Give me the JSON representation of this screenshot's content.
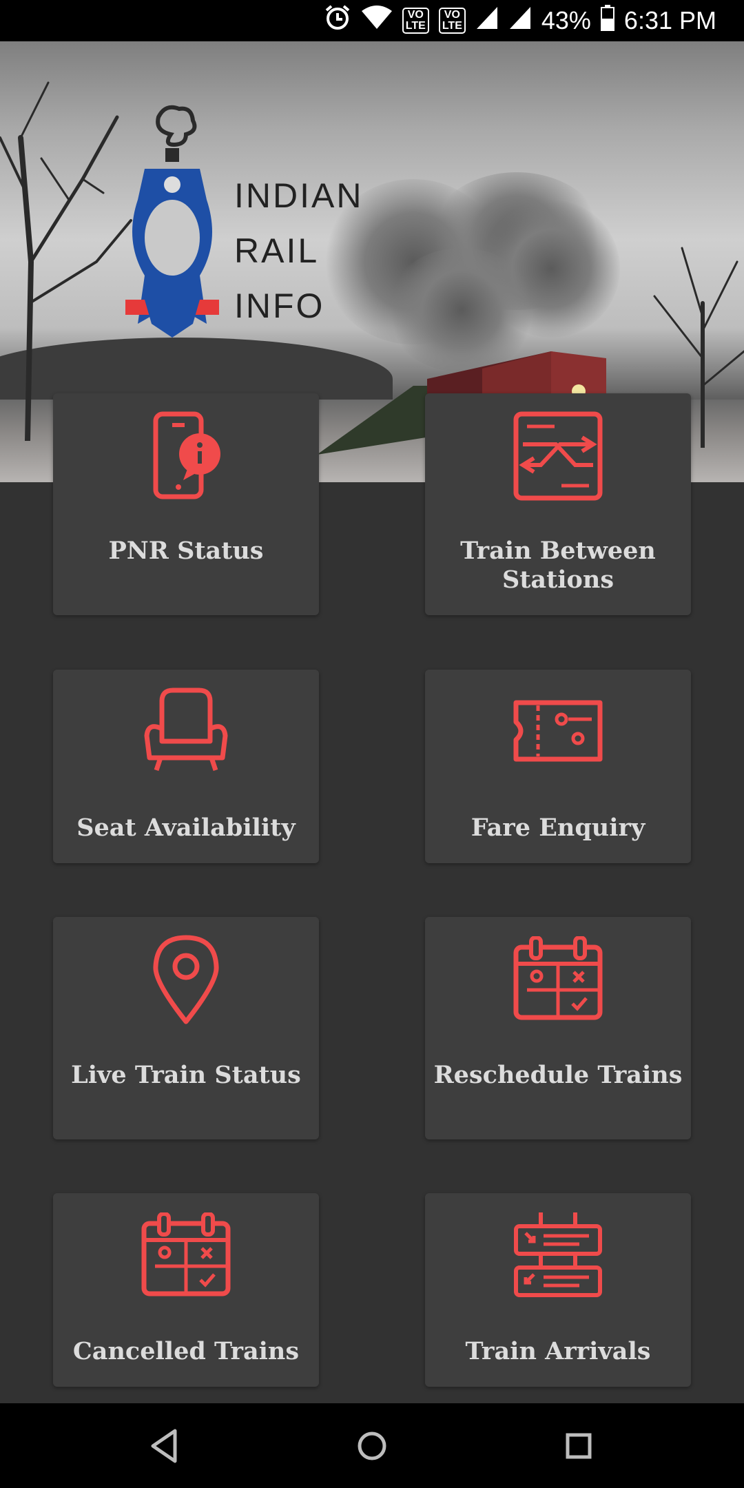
{
  "status_bar": {
    "battery": "43%",
    "time": "6:31 PM",
    "volte1": "VO",
    "lte1": "LTE",
    "volte2": "VO",
    "lte2": "LTE",
    "icons": [
      "alarm-icon",
      "wifi-icon",
      "volte-1-icon",
      "volte-2-icon",
      "signal-1-icon",
      "signal-2-icon",
      "battery-icon"
    ]
  },
  "header": {
    "logo_lines": [
      "INDIAN",
      "RAIL",
      "INFO"
    ]
  },
  "menu": {
    "items": [
      {
        "label": "PNR Status",
        "icon": "phone-info-icon"
      },
      {
        "label": "Train Between Stations",
        "icon": "station-board-icon"
      },
      {
        "label": "Seat Availability",
        "icon": "armchair-icon"
      },
      {
        "label": "Fare Enquiry",
        "icon": "ticket-icon"
      },
      {
        "label": "Live Train Status",
        "icon": "location-pin-icon"
      },
      {
        "label": "Reschedule Trains",
        "icon": "calendar-icon"
      },
      {
        "label": "Cancelled Trains",
        "icon": "calendar-icon"
      },
      {
        "label": "Train Arrivals",
        "icon": "arrivals-board-icon"
      }
    ]
  },
  "nav": {
    "buttons": [
      "back-icon",
      "home-icon",
      "recents-icon"
    ]
  },
  "colors": {
    "accent": "#f04b4b",
    "tile_bg": "#3e3e3e",
    "page_bg": "#323232",
    "label_text": "#dcdcdc",
    "logo_blue": "#1e4fa6",
    "logo_red": "#e63a3a"
  }
}
